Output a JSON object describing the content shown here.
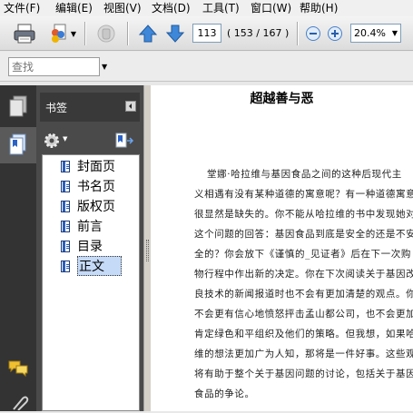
{
  "menu": [
    {
      "label": "文件(F)",
      "name": "menu-file"
    },
    {
      "label": "编辑(E)",
      "name": "menu-edit"
    },
    {
      "label": "视图(V)",
      "name": "menu-view"
    },
    {
      "label": "文档(D)",
      "name": "menu-document"
    },
    {
      "label": "工具(T)",
      "name": "menu-tools"
    },
    {
      "label": "窗口(W)",
      "name": "menu-window"
    },
    {
      "label": "帮助(H)",
      "name": "menu-help"
    }
  ],
  "toolbar": {
    "page_number": "113",
    "page_count": "( 153 / 167 )",
    "zoom": "20.4%"
  },
  "search": {
    "placeholder": "查找"
  },
  "panel": {
    "title": "书签"
  },
  "bookmarks": [
    {
      "label": "封面页"
    },
    {
      "label": "书名页"
    },
    {
      "label": "版权页"
    },
    {
      "label": "前言"
    },
    {
      "label": "目录"
    },
    {
      "label": "正文"
    }
  ],
  "selected_bookmark": "正文",
  "document": {
    "title": "超越善与恶",
    "lines": [
      "堂娜·哈拉维与基因食品之间的这种后现代主",
      "义相遇有没有某种道德的寓意呢？有一种道德寓意",
      "很显然是缺失的。你不能从哈拉维的书中发现她对",
      "这个问题的回答：基因食品到底是安全的还是不安",
      "全的？你会放下《谨慎的_见证者》后在下一次购",
      "物行程中作出新的决定。你在下次阅读关于基因改",
      "良技术的新闻报道时也不会有更加清楚的观点。你",
      "不会更有信心地愤怒抨击孟山都公司，也不会更加",
      "肯定绿色和平组织及他们的策略。但我想，如果哈拉",
      "维的想法更加广为人知，那将是一件好事。这些观念",
      "将有助于整个关于基因问题的讨论，包括关于基因",
      "食品的争论。"
    ]
  },
  "colors": {
    "selection": "#c5daf7",
    "panel_bg": "#4a4a4a",
    "nav_bg": "#333333"
  }
}
